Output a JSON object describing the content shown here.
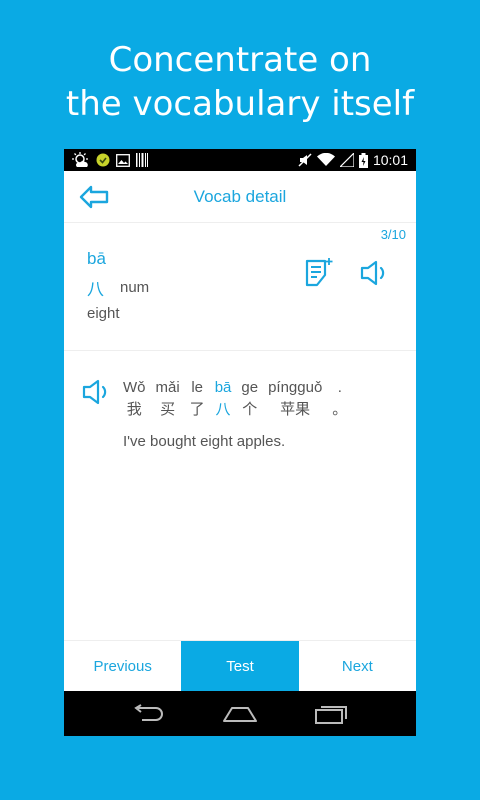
{
  "promo": {
    "line1": "Concentrate on",
    "line2": "the vocabulary itself"
  },
  "status_bar": {
    "time": "10:01",
    "left_icons": [
      "weather-icon",
      "app-icon",
      "image-icon",
      "barcode-icon"
    ],
    "right_icons": [
      "mute-icon",
      "wifi-icon",
      "signal-icon",
      "battery-charging-icon"
    ]
  },
  "app_bar": {
    "title": "Vocab detail",
    "back_icon": "back-arrow-icon"
  },
  "word": {
    "counter": "3/10",
    "pinyin": "bā",
    "hanzi": "八",
    "pos": "num",
    "meaning": "eight"
  },
  "example": {
    "words": [
      {
        "py": "Wǒ",
        "hz": "我",
        "highlight": false
      },
      {
        "py": "mǎi",
        "hz": "买",
        "highlight": false
      },
      {
        "py": "le",
        "hz": "了",
        "highlight": false
      },
      {
        "py": "bā",
        "hz": "八",
        "highlight": true
      },
      {
        "py": "ge",
        "hz": "个",
        "highlight": false
      },
      {
        "py": "píngguǒ",
        "hz": "苹果",
        "highlight": false
      },
      {
        "py": ".",
        "hz": "。",
        "highlight": false
      }
    ],
    "translation": "I've bought eight apples."
  },
  "tabs": {
    "previous": "Previous",
    "test": "Test",
    "next": "Next"
  },
  "colors": {
    "accent": "#1ba6de",
    "background": "#0aaae4"
  }
}
